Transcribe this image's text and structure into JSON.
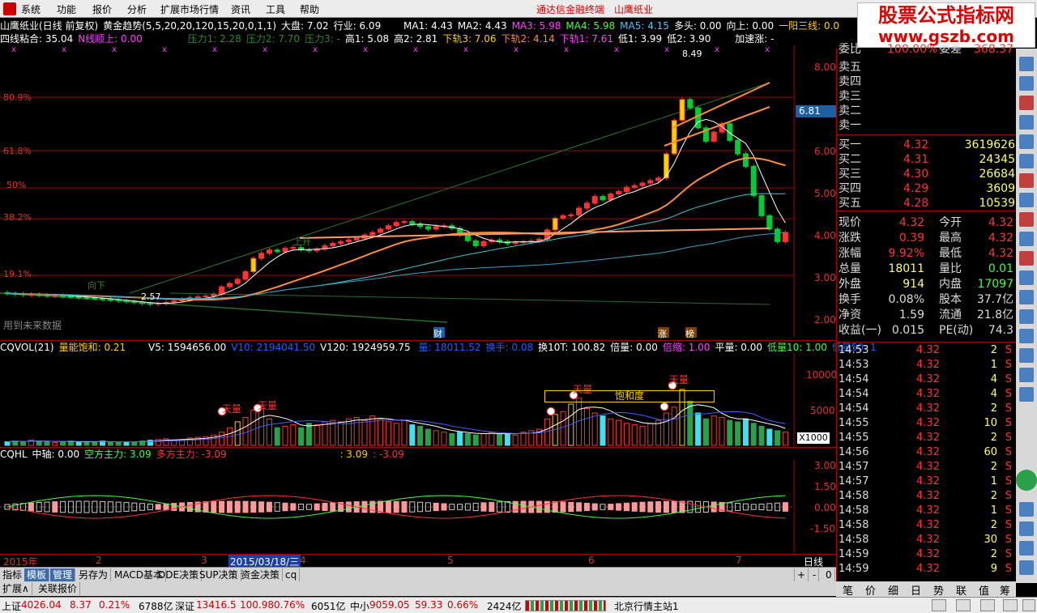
{
  "menu": {
    "items": [
      "系统",
      "功能",
      "报价",
      "分析",
      "扩展市场行情",
      "资讯",
      "工具",
      "帮助"
    ],
    "broker": "通达信金融终端",
    "stock_name_header": "山鹰纸业"
  },
  "watermark": {
    "cn": "股票公式指标网",
    "url": "www.gszb.com"
  },
  "info": {
    "row1": {
      "title": "山鹰纸业(日线 前复权)",
      "indicator": "黄金趋势(5,5,20,20,120,15,20,0,1,1)",
      "dapan": "大盘: 7.02",
      "hangye": "行业: 6.09",
      "ma1": "MA1: 4.43",
      "ma2": "MA2: 4.43",
      "ma3": "MA3: 5.98",
      "ma4": "MA4: 5.98",
      "ma5": "MA5: 4.15",
      "duotou": "多头: 0.00",
      "xiangshang": "向上: 0.00",
      "yiyang": "一阳三线: 0.0"
    },
    "row2": {
      "sixian": "四线粘合: 35.04",
      "nshun": "N线顺上: 0.00",
      "yali1": "压力1: 2.28",
      "yali2": "压力2: 7.70",
      "yali3": "压力3: -",
      "gao1": "高1: 5.08",
      "gao2": "高2: 2.81",
      "xiagui3": "下轨3: 7.06",
      "xiagui2": "下轨2: 4.14",
      "xiagui1": "下轨1: 7.61",
      "di1": "低1: 3.99",
      "di2": "低2: 3.90",
      "jiasu": "加速涨: -"
    }
  },
  "main_chart": {
    "fib_labels": [
      "80.9%",
      "61.8%",
      "50%",
      "38.2%",
      "19.1%"
    ],
    "price_axis": [
      "8.00",
      "7.00",
      "6.00",
      "5.00",
      "4.00",
      "3.00",
      "2.00"
    ],
    "current_price_tag": "6.81",
    "peak_label": "8.49",
    "low_label": "2.57",
    "annotations": {
      "xiangxia": "向下",
      "shangsheng": "上升",
      "future_note": "用到未来数据",
      "cai": "财",
      "zhang": "涨",
      "bang": "榜"
    },
    "candles_open": [
      2.88,
      2.86,
      2.85,
      2.83,
      2.84,
      2.82,
      2.8,
      2.81,
      2.79,
      2.78,
      2.76,
      2.75,
      2.74,
      2.72,
      2.7,
      2.68,
      2.66,
      2.64,
      2.62,
      2.6,
      2.62,
      2.65,
      2.68,
      2.72,
      2.76,
      2.78,
      2.8,
      2.84,
      3.02,
      3.1,
      3.2,
      3.38,
      3.7,
      3.82,
      3.9,
      3.86,
      3.94,
      3.96,
      3.9,
      3.88,
      3.92,
      4.0,
      4.06,
      4.1,
      4.14,
      4.18,
      4.26,
      4.32,
      4.4,
      4.48,
      4.56,
      4.58,
      4.52,
      4.46,
      4.4,
      4.46,
      4.48,
      4.42,
      4.26,
      4.12,
      4.0,
      4.1,
      4.14,
      4.1,
      4.06,
      4.08,
      4.1,
      4.12,
      4.16,
      4.38,
      4.66,
      4.72,
      4.74,
      4.9,
      5.02,
      5.18,
      5.1,
      5.24,
      5.3,
      5.4,
      5.44,
      5.5,
      5.56,
      5.62,
      6.2,
      7.0,
      7.5,
      7.3,
      6.82,
      6.5,
      6.72,
      6.92,
      6.52,
      6.2,
      5.9,
      5.2,
      4.72,
      4.4,
      4.1
    ],
    "candles_close": [
      2.86,
      2.85,
      2.83,
      2.84,
      2.82,
      2.8,
      2.81,
      2.79,
      2.78,
      2.76,
      2.75,
      2.74,
      2.72,
      2.7,
      2.68,
      2.66,
      2.64,
      2.62,
      2.6,
      2.62,
      2.65,
      2.68,
      2.72,
      2.76,
      2.78,
      2.8,
      2.84,
      3.02,
      3.1,
      3.2,
      3.38,
      3.7,
      3.82,
      3.9,
      3.86,
      3.94,
      3.96,
      3.9,
      3.88,
      3.92,
      4.0,
      4.06,
      4.1,
      4.14,
      4.18,
      4.26,
      4.32,
      4.4,
      4.48,
      4.56,
      4.58,
      4.52,
      4.46,
      4.4,
      4.46,
      4.48,
      4.42,
      4.26,
      4.12,
      4.0,
      4.1,
      4.14,
      4.1,
      4.06,
      4.08,
      4.1,
      4.12,
      4.16,
      4.38,
      4.66,
      4.72,
      4.74,
      4.9,
      5.02,
      5.18,
      5.1,
      5.24,
      5.3,
      5.4,
      5.44,
      5.5,
      5.56,
      5.62,
      6.2,
      7.0,
      7.5,
      7.3,
      6.82,
      6.5,
      6.72,
      6.92,
      6.52,
      6.2,
      5.9,
      5.2,
      4.72,
      4.4,
      4.1,
      4.32
    ]
  },
  "volume": {
    "header": {
      "name": "CQVOL(21)",
      "baoneng": "量能饱和: 0.21",
      "v5": "V5: 1594656.00",
      "v10": "V10: 2194041.50",
      "v120": "V120: 1924959.75",
      "liang": "量: 18011.52",
      "huanshou": "换手: 0.08",
      "huan10t": "换10T: 100.82",
      "beiliang": "倍量: 0.00",
      "beisuo": "倍缩: 1.00",
      "pingliang": "平量: 0.00",
      "diliang10": "低量10: 1.00",
      "diliang50": "低量50: 1"
    },
    "axis": [
      "10000",
      "5000"
    ],
    "unit": "X1000",
    "labels": {
      "tianliang": "天量",
      "baohedu": "饱和度"
    },
    "values": [
      0.5,
      0.6,
      0.5,
      0.7,
      0.6,
      0.5,
      0.4,
      0.5,
      0.6,
      0.5,
      0.4,
      0.5,
      0.6,
      0.5,
      0.5,
      0.4,
      0.5,
      0.6,
      0.7,
      0.8,
      0.9,
      0.7,
      0.8,
      1.0,
      1.1,
      1.2,
      1.4,
      1.8,
      2.4,
      3.2,
      3.8,
      4.8,
      5.0,
      3.6,
      2.4,
      2.6,
      2.8,
      2.4,
      3.0,
      2.8,
      3.2,
      3.4,
      3.2,
      3.6,
      3.8,
      3.4,
      4.0,
      3.6,
      3.2,
      3.0,
      3.4,
      2.8,
      2.6,
      2.2,
      2.0,
      1.8,
      1.6,
      1.8,
      1.6,
      1.4,
      1.6,
      1.8,
      1.5,
      1.6,
      1.4,
      1.8,
      2.0,
      2.2,
      3.6,
      4.2,
      4.6,
      5.6,
      6.4,
      5.0,
      4.4,
      4.0,
      3.6,
      3.4,
      3.0,
      2.8,
      2.6,
      3.0,
      3.4,
      4.4,
      5.2,
      7.6,
      6.0,
      4.4,
      3.6,
      4.0,
      3.8,
      3.4,
      3.2,
      3.6,
      3.0,
      2.6,
      2.2,
      2.0,
      1.8
    ]
  },
  "macd": {
    "header": {
      "name": "CQHL",
      "zhongzhou": "中轴: 0.00",
      "kongfang": "空方主力: 3.09",
      "duofang": "多方主力: -3.09",
      "v1": ": 3.09",
      "v2": ": -3.09"
    },
    "axis": [
      "3.00",
      "1.50",
      "0.00",
      "-1.50"
    ]
  },
  "date_axis": {
    "year": "2015年",
    "m2": "2",
    "m3": "3",
    "cursor_date": "2015/03/18/三",
    "m4": "4",
    "m5": "5",
    "m6": "6",
    "m7": "7",
    "period": "日线"
  },
  "bottom_tabs": [
    "指标",
    "模板",
    "管理",
    "另存为",
    "MACD基本",
    "DDE决策",
    "SUP决策",
    "资金决策",
    "cq"
  ],
  "ext_tabs": [
    "扩展∧",
    "关联报价"
  ],
  "right_panel": {
    "weibi_label": "委比",
    "weibi_value": "100.00%",
    "weicha_label": "委差",
    "weicha_value": "368.37",
    "sells": [
      "卖五",
      "卖四",
      "卖三",
      "卖二",
      "卖一"
    ],
    "buys": [
      {
        "label": "买一",
        "price": "4.32",
        "vol": "3619626"
      },
      {
        "label": "买二",
        "price": "4.31",
        "vol": "24345"
      },
      {
        "label": "买三",
        "price": "4.30",
        "vol": "26684"
      },
      {
        "label": "买四",
        "price": "4.29",
        "vol": "3609"
      },
      {
        "label": "买五",
        "price": "4.28",
        "vol": "10539"
      }
    ],
    "stats": [
      {
        "l1": "现价",
        "v1": "4.32",
        "l2": "今开",
        "v2": "4.32"
      },
      {
        "l1": "涨跌",
        "v1": "0.39",
        "l2": "最高",
        "v2": "4.32"
      },
      {
        "l1": "涨幅",
        "v1": "9.92%",
        "l2": "最低",
        "v2": "4.32"
      },
      {
        "l1": "总量",
        "v1": "18011",
        "l2": "量比",
        "v2": "0.01"
      },
      {
        "l1": "外盘",
        "v1": "914",
        "l2": "内盘",
        "v2": "17097"
      },
      {
        "l1": "换手",
        "v1": "0.08%",
        "l2": "股本",
        "v2": "37.7亿"
      },
      {
        "l1": "净资",
        "v1": "1.59",
        "l2": "流通",
        "v2": "21.8亿"
      },
      {
        "l1": "收益(一)",
        "v1": "0.015",
        "l2": "PE(动)",
        "v2": "74.3"
      }
    ],
    "ticks": [
      {
        "t": "14:53",
        "p": "4.32",
        "v": "2",
        "d": "S"
      },
      {
        "t": "14:53",
        "p": "4.32",
        "v": "1",
        "d": "S"
      },
      {
        "t": "14:54",
        "p": "4.32",
        "v": "4",
        "d": "S"
      },
      {
        "t": "14:54",
        "p": "4.32",
        "v": "4",
        "d": "S"
      },
      {
        "t": "14:54",
        "p": "4.32",
        "v": "2",
        "d": "S"
      },
      {
        "t": "14:55",
        "p": "4.32",
        "v": "10",
        "d": "S"
      },
      {
        "t": "14:55",
        "p": "4.32",
        "v": "2",
        "d": "S"
      },
      {
        "t": "14:56",
        "p": "4.32",
        "v": "60",
        "d": "S"
      },
      {
        "t": "14:57",
        "p": "4.32",
        "v": "2",
        "d": "S"
      },
      {
        "t": "14:57",
        "p": "4.32",
        "v": "1",
        "d": "S"
      },
      {
        "t": "14:58",
        "p": "4.32",
        "v": "2",
        "d": "S"
      },
      {
        "t": "14:58",
        "p": "4.32",
        "v": "1",
        "d": "S"
      },
      {
        "t": "14:58",
        "p": "4.32",
        "v": "2",
        "d": "S"
      },
      {
        "t": "14:58",
        "p": "4.32",
        "v": "30",
        "d": "S"
      },
      {
        "t": "14:59",
        "p": "4.32",
        "v": "2",
        "d": "S"
      },
      {
        "t": "14:59",
        "p": "4.32",
        "v": "9",
        "d": "S"
      }
    ],
    "tabs": [
      "笔",
      "价",
      "细",
      "日",
      "势",
      "联",
      "值",
      "筹"
    ]
  },
  "status": {
    "sh_label": "上证",
    "sh_val": "4026.04",
    "sh_chg": "8.37",
    "sh_pct": "0.21%",
    "sh_amt": "6788亿",
    "sz_label": "深证",
    "sz_val": "13416.5",
    "sz_chg": "100.98",
    "sz_pct": "0.76%",
    "sz_amt": "6051亿",
    "zx_label": "中小",
    "zx_val": "9059.05",
    "zx_chg": "59.33",
    "zx_pct": "0.66%",
    "zx_amt": "2424亿",
    "server": "北京行情主站1"
  },
  "colors": {
    "up": "#ff3333",
    "down": "#00cc33",
    "ma_orange": "#ff8c3a",
    "ma_cyan": "#40c8d8",
    "gold": "#ffd000"
  },
  "icons": [
    "window-minimize-icon",
    "window-restore-icon",
    "window-close-icon"
  ]
}
